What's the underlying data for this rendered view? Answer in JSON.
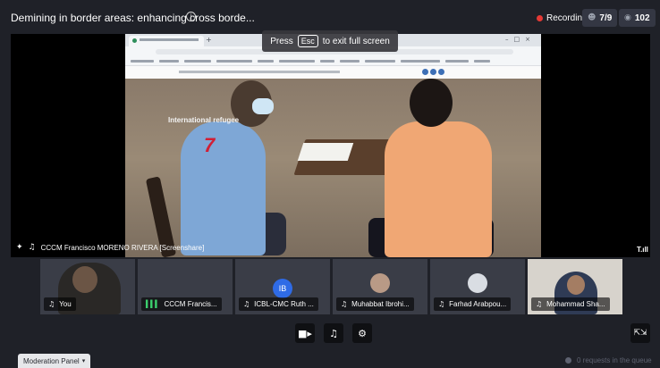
{
  "topbar": {
    "title": "Demining in border areas: enhancing cross borde...",
    "info_icon": "i",
    "recording_label": "Recording",
    "participants_count": "7/9",
    "viewers_count": "102"
  },
  "screenshare": {
    "esc_prefix": "Press",
    "esc_key": "Esc",
    "esc_suffix": "to exit full screen",
    "video_caption": "International refugee",
    "video_number": "7",
    "presenter_label": "CCCM Francisco MORENO RIVERA [Screenshare]",
    "signal_label": "T.ıll"
  },
  "tiles": [
    {
      "label": "You",
      "mic": "muted"
    },
    {
      "label": "CCCM Francis...",
      "mic": "active"
    },
    {
      "label": "ICBL-CMC Ruth ...",
      "mic": "muted",
      "initials": "IB"
    },
    {
      "label": "Muhabbat Ibrohi...",
      "mic": "muted"
    },
    {
      "label": "Farhad Arabpou...",
      "mic": "muted"
    },
    {
      "label": "Mohammad Sha...",
      "mic": "muted"
    }
  ],
  "controls": {
    "camera_icon": "camera-icon",
    "mic_icon": "mic-muted-icon",
    "settings_icon": "gear-icon"
  },
  "footer": {
    "moderation_label": "Moderation Panel",
    "queue_label": "0 requests in the queue"
  },
  "colors": {
    "background": "#1f2128",
    "tile": "#3a3d47",
    "recording": "#e53935",
    "avatar_blue": "#2f6be6",
    "mic_active": "#3ccf6e"
  }
}
